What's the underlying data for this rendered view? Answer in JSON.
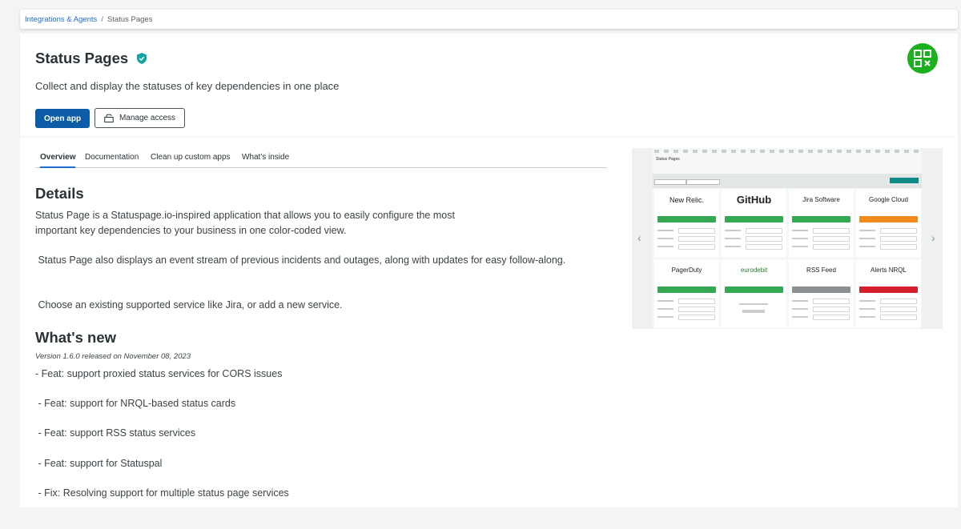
{
  "breadcrumb": {
    "parent": "Integrations & Agents",
    "separator": "/",
    "current": "Status Pages"
  },
  "header": {
    "title": "Status Pages",
    "subtitle": "Collect and display the statuses of key dependencies in one place",
    "open_app_label": "Open app",
    "manage_access_label": "Manage access"
  },
  "tabs": [
    {
      "label": "Overview",
      "active": true
    },
    {
      "label": "Documentation",
      "active": false
    },
    {
      "label": "Clean up custom apps",
      "active": false
    },
    {
      "label": "What's inside",
      "active": false
    }
  ],
  "details": {
    "heading": "Details",
    "paragraphs": [
      "Status Page is a Statuspage.io-inspired application that allows you to easily configure the most important key dependencies to your business in one color-coded view.",
      " Status Page also displays an event stream of previous incidents and outages, along with updates for easy follow-along.",
      " Choose an existing supported service like Jira, or add a new service."
    ]
  },
  "whats_new": {
    "heading": "What's new",
    "version": "Version 1.6.0 released on November 08, 2023",
    "items": [
      "- Feat: support proxied status services for CORS issues",
      " - Feat: support for NRQL-based status cards",
      " - Feat: support RSS status services",
      " - Feat: support for Statuspal",
      " - Fix: Resolving support for multiple status page services"
    ]
  },
  "screenshot": {
    "title": "Status Pages",
    "tiles": [
      {
        "name": "New Relic.",
        "status_color": "#35a853"
      },
      {
        "name": "GitHub",
        "status_color": "#35a853"
      },
      {
        "name": "Jira Software",
        "status_color": "#35a853"
      },
      {
        "name": "Google Cloud",
        "status_color": "#f08a1c"
      },
      {
        "name": "PagerDuty",
        "status_color": "#35a853"
      },
      {
        "name": "eurodebit",
        "status_color": "#35a853"
      },
      {
        "name": "RSS Feed",
        "status_color": "#8a8f92"
      },
      {
        "name": "Alerts NRQL",
        "status_color": "#d3202b"
      }
    ]
  },
  "colors": {
    "primary_button": "#0c5ca8",
    "link": "#1d6bd3",
    "verified_badge": "#0fa5a5",
    "app_logo": "#1ab01e"
  }
}
